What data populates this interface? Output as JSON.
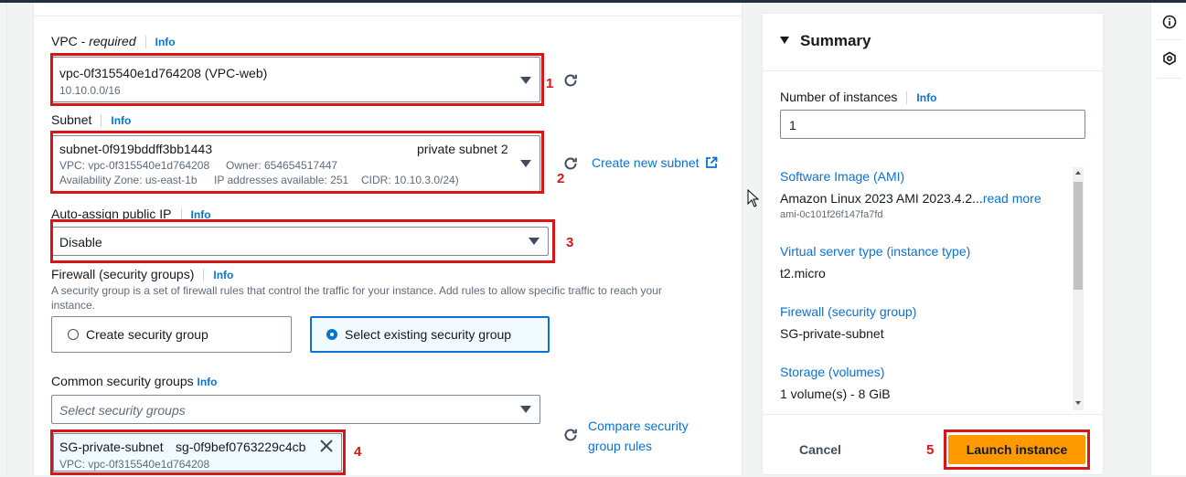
{
  "network": {
    "vpc": {
      "label": "VPC - ",
      "label_required": "required",
      "info": "Info",
      "value": "vpc-0f315540e1d764208 (VPC-web)",
      "cidr": "10.10.0.0/16",
      "annotation": "1"
    },
    "subnet": {
      "label": "Subnet",
      "info": "Info",
      "value": "subnet-0f919bddff3bb1443",
      "name": "private subnet 2",
      "vpc_line": "VPC: vpc-0f315540e1d764208",
      "owner_line": "Owner: 654654517447",
      "az_line": "Availability Zone: us-east-1b",
      "ip_line": "IP addresses available: 251",
      "cidr_line": "CIDR: 10.10.3.0/24)",
      "create_link": "Create new subnet",
      "annotation": "2"
    },
    "public_ip": {
      "label": "Auto-assign public IP",
      "info": "Info",
      "value": "Disable",
      "annotation": "3"
    },
    "firewall": {
      "label": "Firewall (security groups)",
      "info": "Info",
      "description": "A security group is a set of firewall rules that control the traffic for your instance. Add rules to allow specific traffic to reach your",
      "description_line2": "instance.",
      "option_create": "Create security group",
      "option_select": "Select existing security group",
      "selected_option": "Select existing security group"
    },
    "common_sg": {
      "label": "Common security groups",
      "info": "Info",
      "placeholder": "Select security groups",
      "compare_link_line1": "Compare security",
      "compare_link_line2": "group rules",
      "token_name": "SG-private-subnet",
      "token_id": "sg-0f9bef0763229c4cb",
      "token_vpc": "VPC: vpc-0f315540e1d764208",
      "annotation": "4"
    }
  },
  "summary": {
    "title": "Summary",
    "instances_label": "Number of instances",
    "instances_info": "Info",
    "instances_value": "1",
    "ami_label": "Software Image (AMI)",
    "ami_value": "Amazon Linux 2023 AMI 2023.4.2...",
    "ami_read_more": "read more",
    "ami_id": "ami-0c101f26f147fa7fd",
    "type_label": "Virtual server type (instance type)",
    "type_value": "t2.micro",
    "firewall_label": "Firewall (security group)",
    "firewall_value": "SG-private-subnet",
    "storage_label": "Storage (volumes)",
    "storage_value": "1 volume(s) - 8 GiB",
    "cancel": "Cancel",
    "launch": "Launch instance",
    "annotation": "5"
  },
  "colors": {
    "annotation_red": "#d91515",
    "link_blue": "#0972d3",
    "launch_orange": "#ff9900"
  },
  "icons": [
    "refresh-icon",
    "external-link-icon",
    "caret-down-icon",
    "close-icon",
    "info-circle-icon",
    "settings-hex-icon",
    "mouse-cursor-icon"
  ]
}
